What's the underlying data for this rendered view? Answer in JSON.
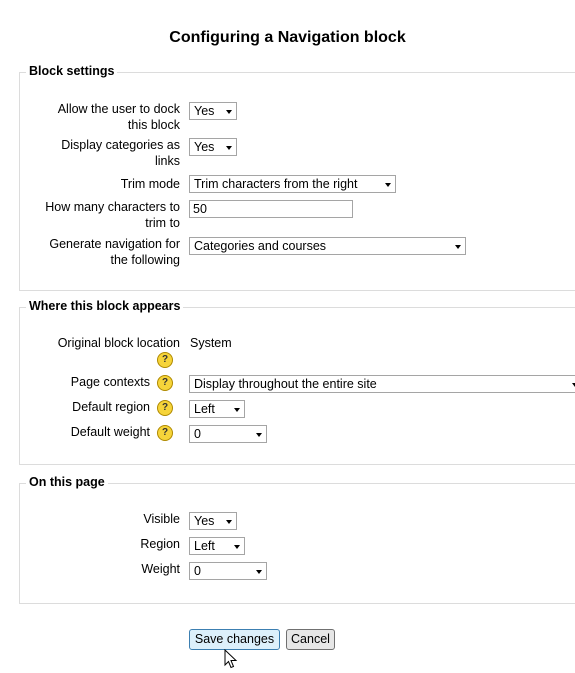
{
  "page": {
    "title": "Configuring a Navigation block"
  },
  "block_settings": {
    "legend": "Block settings",
    "dock_label_1": "Allow the user to dock",
    "dock_label_2": "this block",
    "dock_value": "Yes",
    "categories_label_1": "Display categories as",
    "categories_label_2": "links",
    "categories_value": "Yes",
    "trim_mode_label": "Trim mode",
    "trim_mode_value": "Trim characters from the right",
    "trim_length_label_1": "How many characters to",
    "trim_length_label_2": "trim to",
    "trim_length_value": "50",
    "generate_label_1": "Generate navigation for",
    "generate_label_2": "the following",
    "generate_value": "Categories and courses"
  },
  "where_appears": {
    "legend": "Where this block appears",
    "original_location_label": "Original block location",
    "original_location_value": "System",
    "page_contexts_label": "Page contexts",
    "page_contexts_value": "Display throughout the entire site",
    "default_region_label": "Default region",
    "default_region_value": "Left",
    "default_weight_label": "Default weight",
    "default_weight_value": "0"
  },
  "on_this_page": {
    "legend": "On this page",
    "visible_label": "Visible",
    "visible_value": "Yes",
    "region_label": "Region",
    "region_value": "Left",
    "weight_label": "Weight",
    "weight_value": "0"
  },
  "buttons": {
    "save_label": "Save changes",
    "cancel_label": "Cancel"
  },
  "icons": {
    "help": "help-question-icon",
    "dropdown": "chevron-down-icon",
    "cursor": "mouse-pointer-icon"
  },
  "colors": {
    "help_icon": "#f6d43a",
    "save_button_bg": "#dcf0fb",
    "fieldset_border": "#dcdcdc"
  }
}
